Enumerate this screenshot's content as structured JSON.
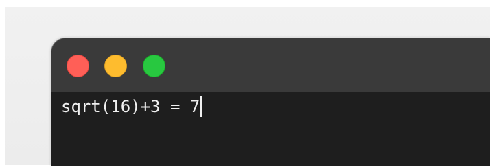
{
  "terminal": {
    "output_line": "sqrt(16)+3 = 7"
  },
  "window_controls": {
    "close_color": "#ff5f57",
    "minimize_color": "#febc2e",
    "zoom_color": "#28c840"
  },
  "colors": {
    "titlebar": "#3a3a3a",
    "content_background": "#1e1e1e",
    "text": "#f0f0f0",
    "desktop": "#ececec"
  },
  "icons": [
    "close-icon",
    "minimize-icon",
    "zoom-icon"
  ]
}
